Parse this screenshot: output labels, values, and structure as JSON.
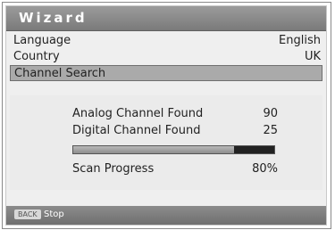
{
  "window": {
    "title": "Wizard"
  },
  "menu": {
    "items": [
      {
        "label": "Language",
        "value": "English"
      },
      {
        "label": "Country",
        "value": "UK"
      },
      {
        "label": "Channel Search",
        "value": ""
      }
    ],
    "selected": "Channel Search"
  },
  "search": {
    "analog_label": "Analog Channel Found",
    "analog_count": "90",
    "digital_label": "Digital Channel Found",
    "digital_count": "25",
    "progress_label": "Scan Progress",
    "progress_text": "80%",
    "progress_fraction": 0.8
  },
  "footer": {
    "key_label": "BACK",
    "action_label": "Stop"
  }
}
